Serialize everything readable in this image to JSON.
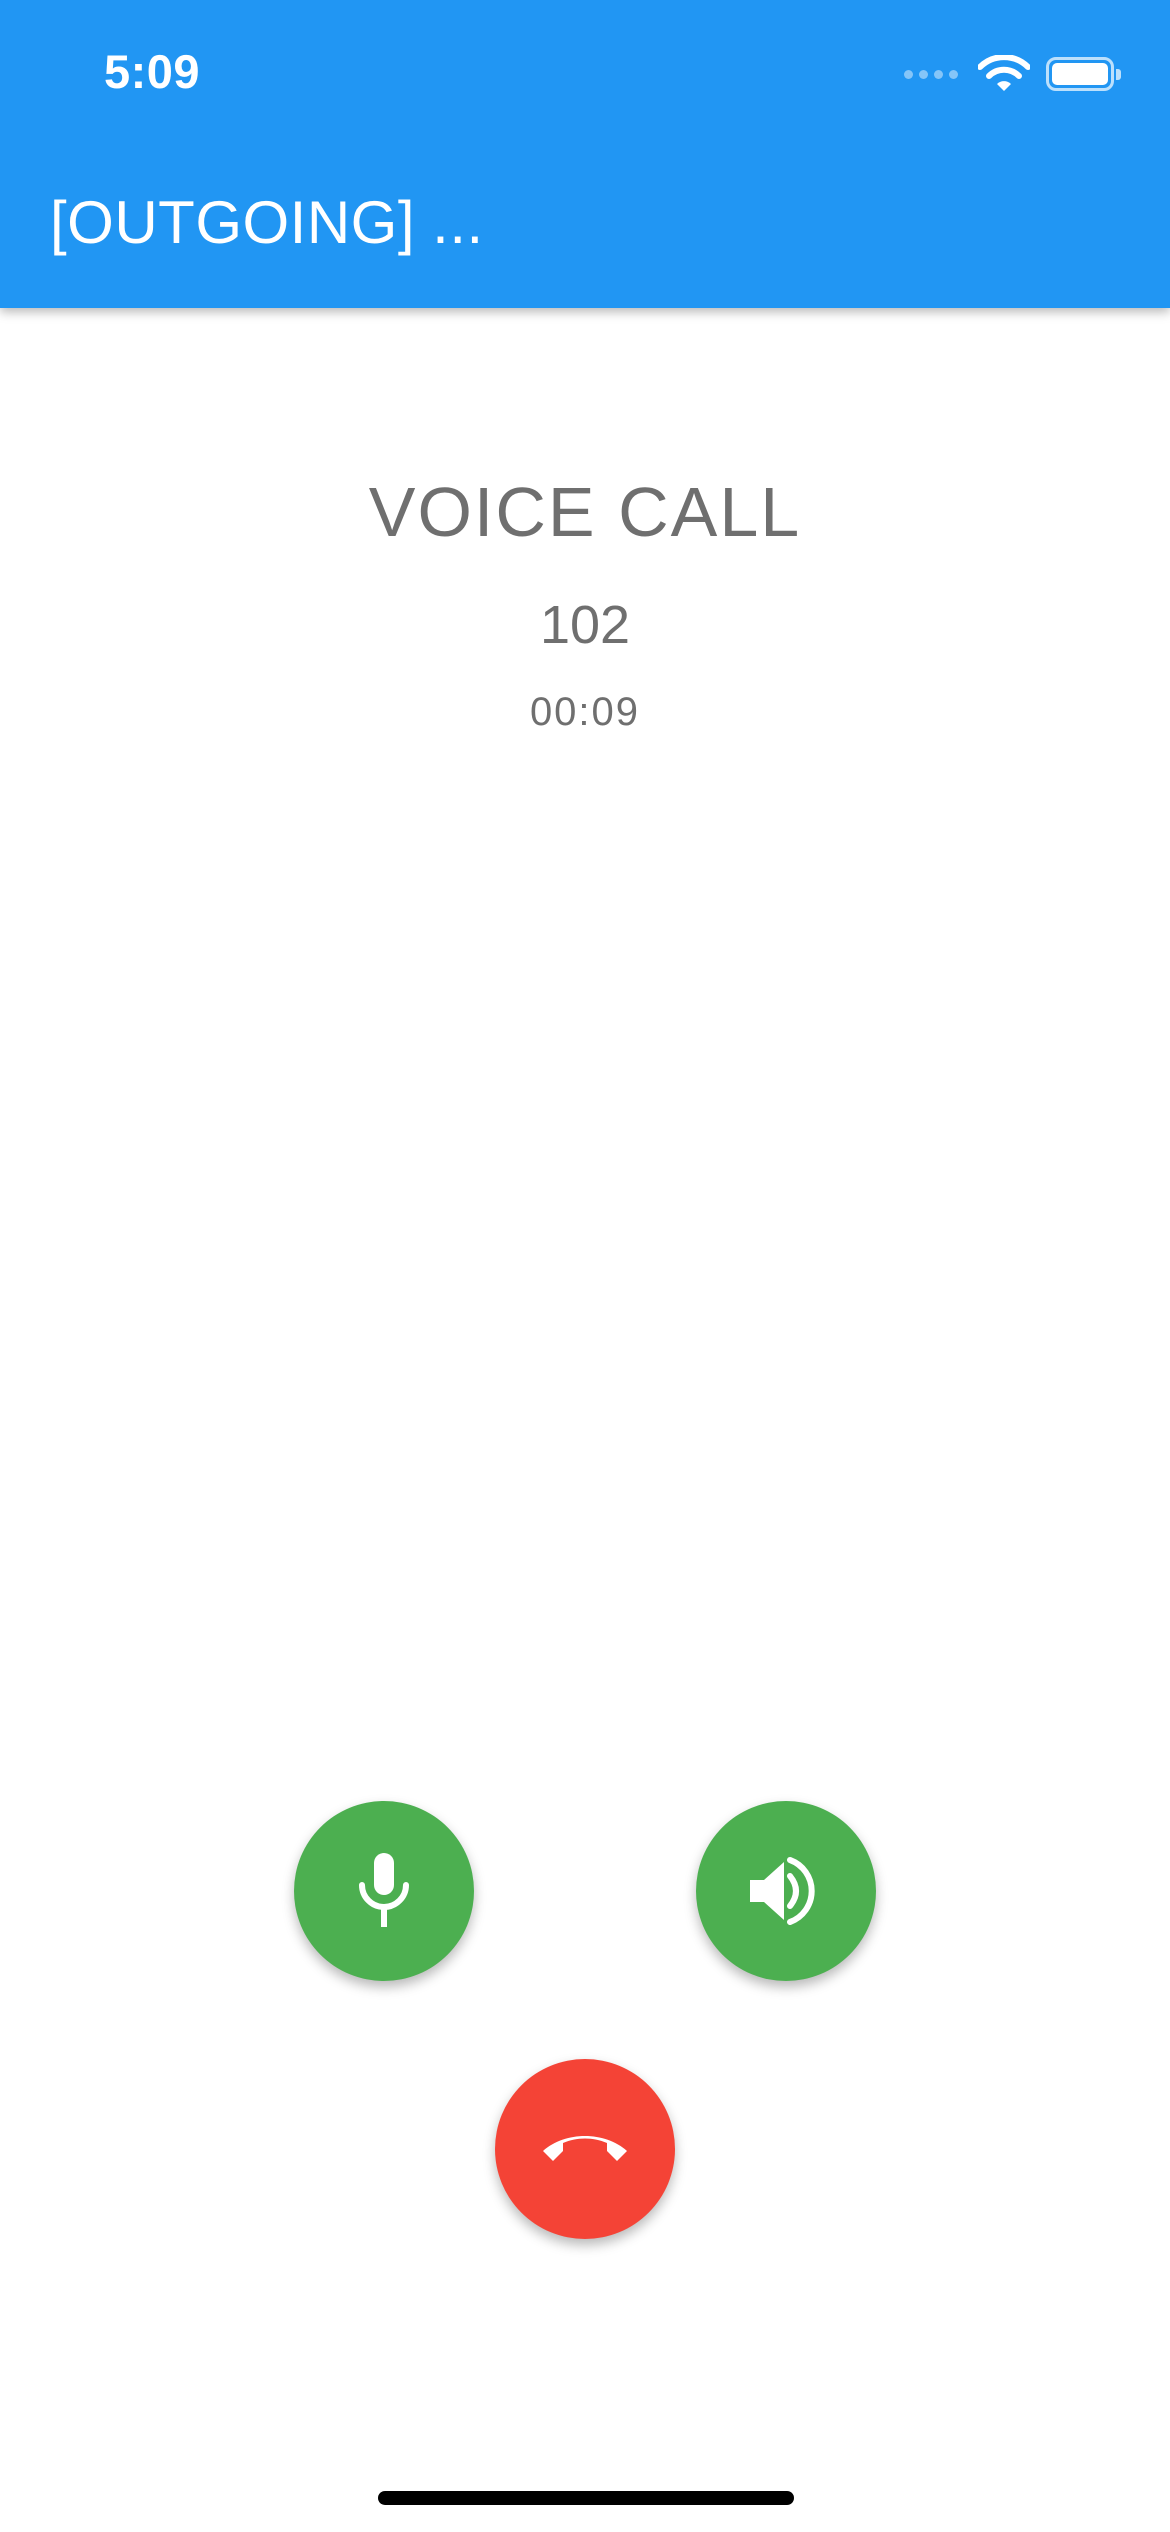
{
  "status_bar": {
    "time": "5:09"
  },
  "header": {
    "title": "[OUTGOING] ...",
    "background_color": "#2196F3"
  },
  "call": {
    "type_label": "VOICE CALL",
    "number": "102",
    "duration": "00:09"
  },
  "controls": {
    "mute": {
      "icon": "mic-icon",
      "color": "#4CAF50"
    },
    "speaker": {
      "icon": "speaker-icon",
      "color": "#4CAF50"
    },
    "hangup": {
      "icon": "call-end-icon",
      "color": "#F44336"
    }
  }
}
